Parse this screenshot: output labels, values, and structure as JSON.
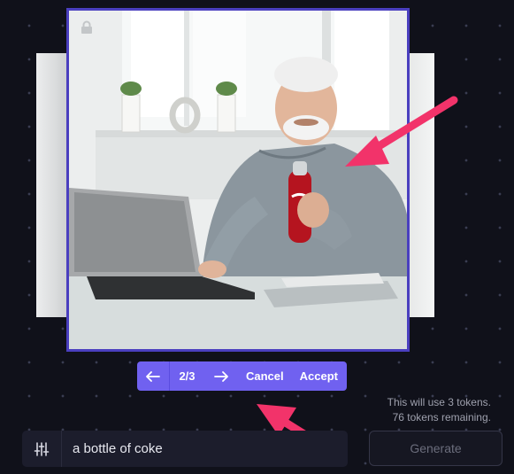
{
  "canvas": {
    "lock_icon": "lock-icon",
    "image_subject": "old man at laptop holding a bottle of coke"
  },
  "toolbar": {
    "prev_icon": "arrow-left-icon",
    "counter": "2/3",
    "next_icon": "arrow-right-icon",
    "cancel_label": "Cancel",
    "accept_label": "Accept"
  },
  "tokens": {
    "line1": "This will use 3 tokens.",
    "line2": "76 tokens remaining."
  },
  "prompt": {
    "settings_icon": "sliders-icon",
    "value": "a bottle of coke"
  },
  "generate": {
    "label": "Generate"
  },
  "colors": {
    "background": "#10111a",
    "accent": "#7061f0",
    "frame_border": "#4a3fbf",
    "annotation_arrow": "#f2336a"
  }
}
